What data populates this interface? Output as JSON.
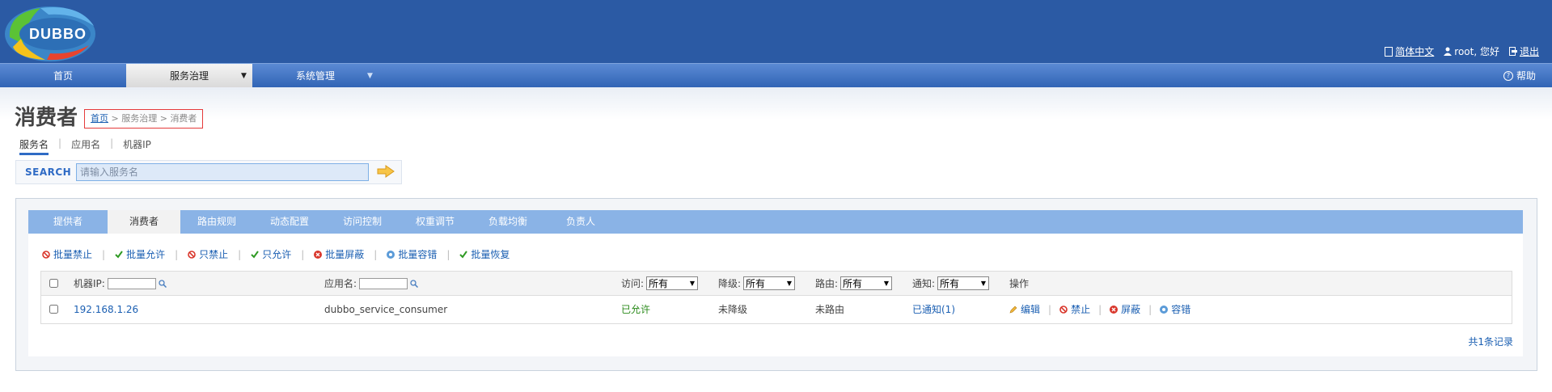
{
  "header": {
    "logo_text": "DUBBO",
    "user_links": [
      {
        "icon": "document-icon",
        "label": "简体中文"
      },
      {
        "icon": "user-icon",
        "label": "root, 您好"
      },
      {
        "icon": "logout-icon",
        "label": "退出"
      }
    ]
  },
  "nav": {
    "items": [
      "首页",
      "服务治理",
      "系统管理"
    ],
    "active": "服务治理",
    "help_label": "帮助",
    "help_icon_glyph": "?"
  },
  "page": {
    "title": "消费者",
    "breadcrumb": {
      "home": "首页",
      "sep1": ">",
      "level2": "服务治理",
      "sep2": ">",
      "level3": "消费者"
    }
  },
  "search": {
    "tabs": [
      "服务名",
      "应用名",
      "机器IP"
    ],
    "active_tab": "服务名",
    "label": "SEARCH",
    "placeholder": "请输入服务名",
    "separator": "|"
  },
  "panel_tabs": [
    "提供者",
    "消费者",
    "路由规则",
    "动态配置",
    "访问控制",
    "权重调节",
    "负载均衡",
    "负责人"
  ],
  "active_panel_tab": "消费者",
  "actions": [
    {
      "label": "批量禁止",
      "icon": "ban-icon"
    },
    {
      "label": "批量允许",
      "icon": "check-icon"
    },
    {
      "label": "只禁止",
      "icon": "ban-icon"
    },
    {
      "label": "只允许",
      "icon": "check-icon"
    },
    {
      "label": "批量屏蔽",
      "icon": "close-circle-icon"
    },
    {
      "label": "批量容错",
      "icon": "gear-icon"
    },
    {
      "label": "批量恢复",
      "icon": "check-icon"
    }
  ],
  "table": {
    "headers": {
      "ip": "机器IP:",
      "app": "应用名:",
      "access": "访问:",
      "degrade": "降级:",
      "route": "路由:",
      "notify": "通知:",
      "ops": "操作"
    },
    "filter_value": "所有",
    "rows": [
      {
        "ip": "192.168.1.26",
        "app": "dubbo_service_consumer",
        "access": "已允许",
        "degrade": "未降级",
        "route": "未路由",
        "notify": "已通知(1)",
        "ops": {
          "edit": "编辑",
          "ban": "禁止",
          "mask": "屏蔽",
          "tolerate": "容错"
        }
      }
    ]
  },
  "record_count": "共1条记录",
  "colors": {
    "header_bg": "#2b5aa4",
    "tab_bar": "#8ab3e6",
    "link": "#1b5fb2",
    "allowed": "#2a8a1a"
  }
}
